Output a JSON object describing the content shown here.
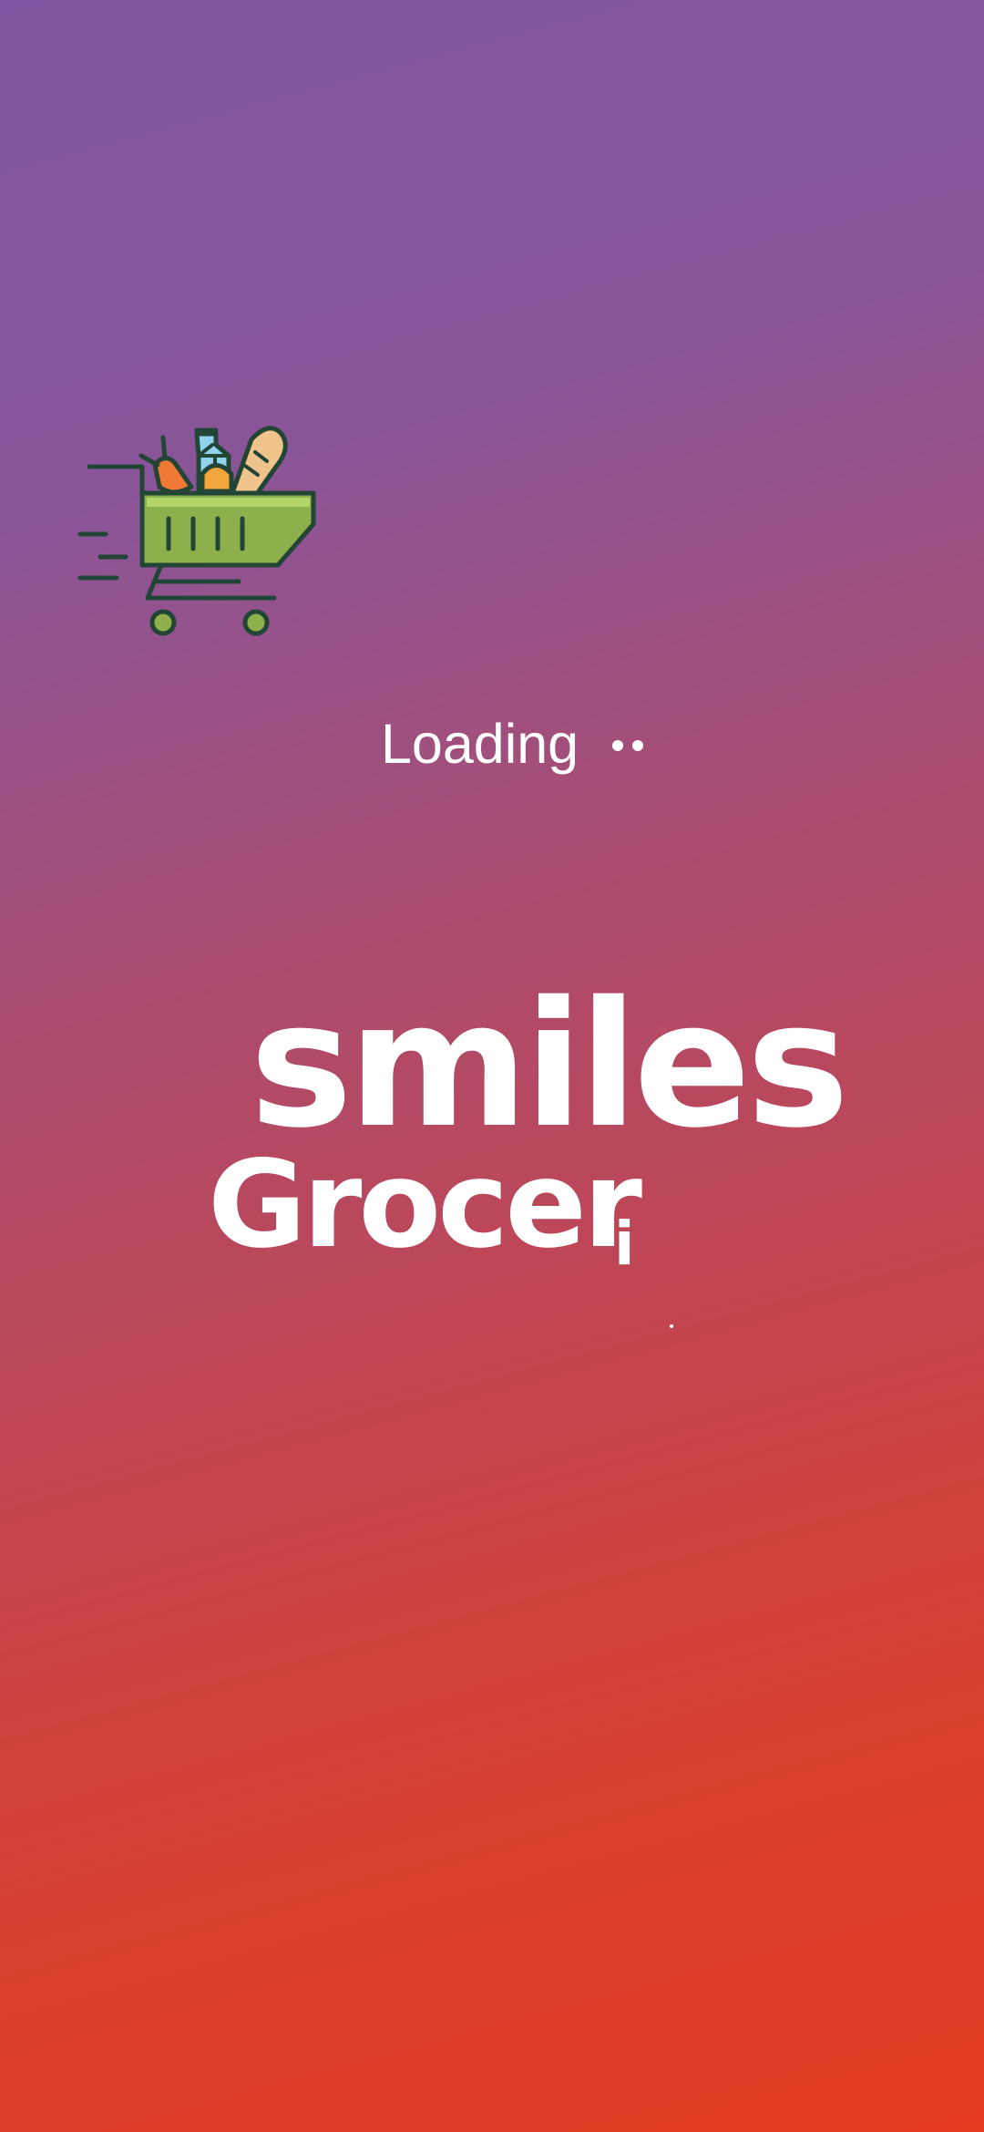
{
  "splash": {
    "loading_text": "Loading",
    "brand": {
      "line1": "smiles",
      "line2": "Grocer",
      "line2_tail": "i"
    },
    "icons": {
      "cart": "shopping-cart-icon"
    },
    "colors": {
      "gradient_start": "#7f56a1",
      "gradient_mid": "#a94d72",
      "gradient_end": "#e43b21",
      "text": "#ffffff",
      "cart_green": "#8db04d",
      "cart_outline": "#234536",
      "milk_blue": "#8fd3ef",
      "carrot_orange": "#f07a35",
      "bread_tan": "#efc48c"
    }
  }
}
